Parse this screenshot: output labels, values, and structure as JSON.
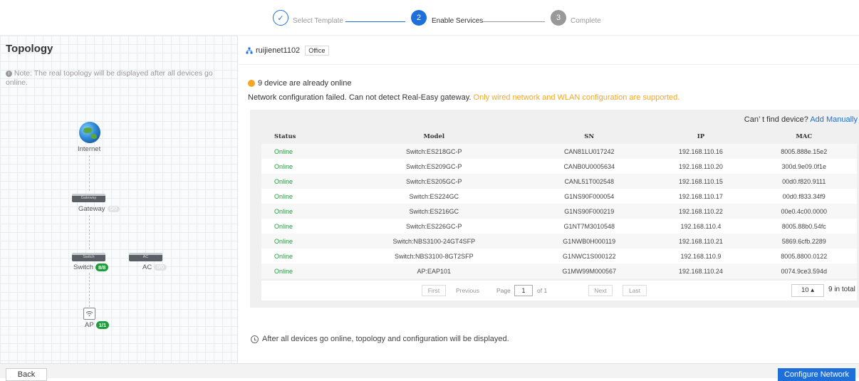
{
  "stepper": {
    "steps": [
      {
        "number": "✓",
        "label": "Select Template",
        "state": "done"
      },
      {
        "number": "2",
        "label": "Enable Services",
        "state": "active"
      },
      {
        "number": "3",
        "label": "Complete",
        "state": "pending"
      }
    ]
  },
  "topology": {
    "title": "Topology",
    "note": "Note: The real topology will be displayed after all devices go online.",
    "nodes": {
      "internet": {
        "label": "Internet"
      },
      "gateway": {
        "label": "Gateway",
        "box_text": "Gateway",
        "badge": "0/0"
      },
      "switch": {
        "label": "Switch",
        "box_text": "Switch",
        "badge": "8/8"
      },
      "ac": {
        "label": "AC",
        "box_text": "AC",
        "badge": "0/0"
      },
      "ap": {
        "label": "AP",
        "badge": "1/1"
      }
    }
  },
  "main": {
    "network_name": "ruijienet1102",
    "network_tag": "Office",
    "online_message": "9 device are already online",
    "error_message": "Network configuration failed. Can not detect Real-Easy gateway.",
    "error_hint": "Only wired network and WLAN configuration are supported.",
    "cant_find": "Can’ t find device?",
    "add_manually": "Add Manually",
    "table": {
      "headers": [
        "Status",
        "Model",
        "SN",
        "IP",
        "MAC"
      ],
      "rows": [
        [
          "Online",
          "Switch:ES218GC-P",
          "CAN81LU017242",
          "192.168.110.16",
          "8005.888e.15e2"
        ],
        [
          "Online",
          "Switch:ES209GC-P",
          "CANB0U0005634",
          "192.168.110.20",
          "300d.9e09.0f1e"
        ],
        [
          "Online",
          "Switch:ES205GC-P",
          "CANL51T002548",
          "192.168.110.15",
          "00d0.f820.9111"
        ],
        [
          "Online",
          "Switch:ES224GC",
          "G1NS90F000054",
          "192.168.110.17",
          "00d0.f833.34f9"
        ],
        [
          "Online",
          "Switch:ES216GC",
          "G1NS90F000219",
          "192.168.110.22",
          "00e0.4c00.0000"
        ],
        [
          "Online",
          "Switch:ES226GC-P",
          "G1NT7M3010548",
          "192.168.110.4",
          "8005.88b0.54fc"
        ],
        [
          "Online",
          "Switch:NBS3100-24GT4SFP",
          "G1NWB0H000119",
          "192.168.110.21",
          "5869.6cfb.2289"
        ],
        [
          "Online",
          "Switch:NBS3100-8GT2SFP",
          "G1NWC1S000122",
          "192.168.110.9",
          "8005.8800.0122"
        ],
        [
          "Online",
          "AP:EAP101",
          "G1MW99M000567",
          "192.168.110.24",
          "0074.9ce3.594d"
        ]
      ]
    },
    "pagination": {
      "first": "First",
      "previous": "Previous",
      "page_label": "Page",
      "page_value": "1",
      "of_text": "of 1",
      "next": "Next",
      "last": "Last",
      "page_size": "10 ▴",
      "total": "9 in total"
    },
    "bottom_note": "After all devices go online, topology and configuration will be displayed."
  },
  "footer": {
    "back": "Back",
    "configure": "Configure Network"
  },
  "colors": {
    "accent": "#1e6fd9",
    "online": "#1f9d3a",
    "warning": "#f5a623"
  }
}
